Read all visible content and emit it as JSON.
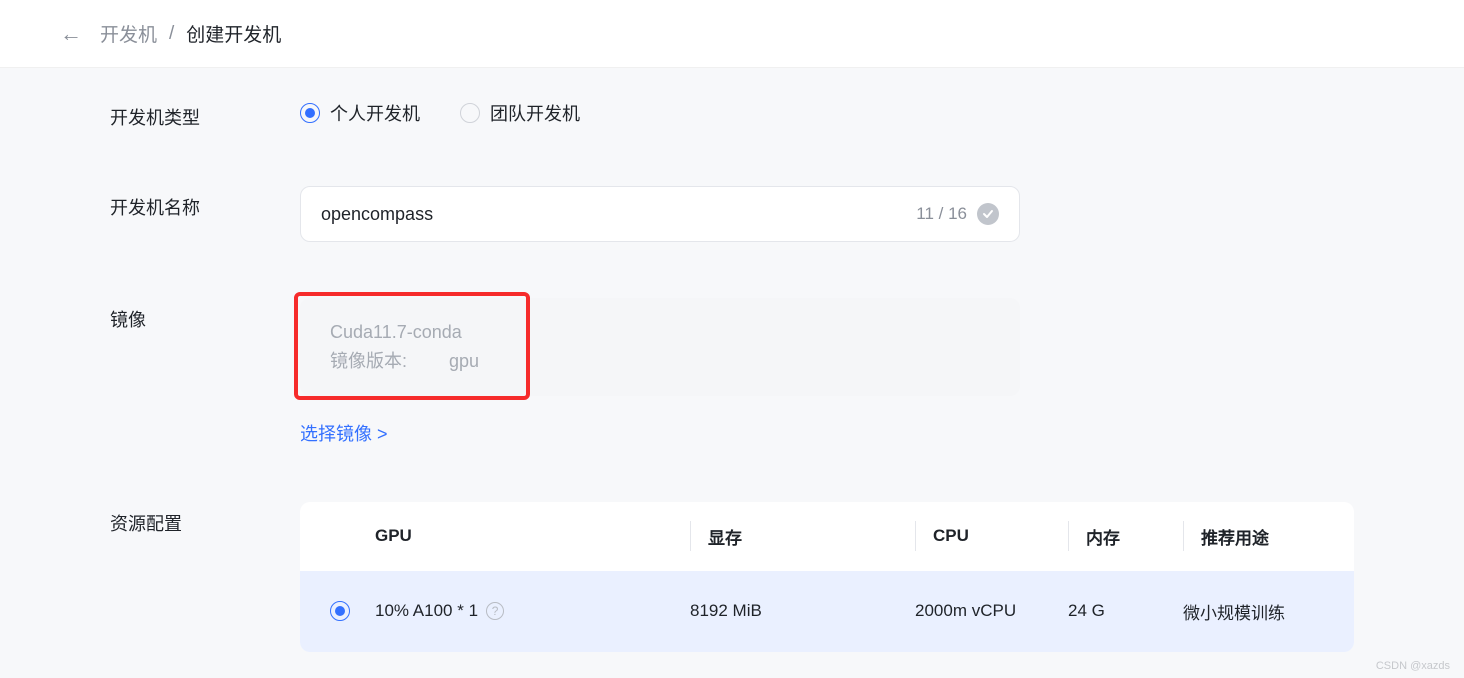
{
  "breadcrumb": {
    "parent": "开发机",
    "sep": "/",
    "current": "创建开发机"
  },
  "labels": {
    "dev_type": "开发机类型",
    "dev_name": "开发机名称",
    "image": "镜像",
    "resource": "资源配置"
  },
  "dev_type": {
    "personal": "个人开发机",
    "team": "团队开发机"
  },
  "dev_name": {
    "value": "opencompass",
    "counter": "11 / 16"
  },
  "image": {
    "name": "Cuda11.7-conda",
    "version_label": "镜像版本:",
    "version_value": "gpu",
    "select_link": "选择镜像 >"
  },
  "res_headers": {
    "gpu": "GPU",
    "vram": "显存",
    "cpu": "CPU",
    "ram": "内存",
    "usage": "推荐用途"
  },
  "res_rows": [
    {
      "gpu": "10% A100 * 1",
      "vram": "8192 MiB",
      "cpu": "2000m vCPU",
      "ram": "24 G",
      "usage": "微小规模训练"
    }
  ],
  "watermark": "CSDN @xazds"
}
